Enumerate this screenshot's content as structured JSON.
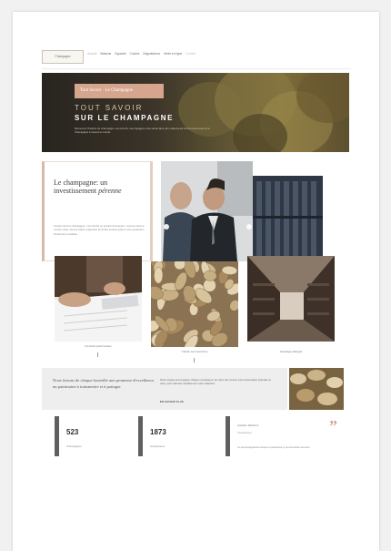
{
  "header": {
    "logo_text": "Champagne",
    "nav": [
      "Accueil",
      "Maisons",
      "Vignoble",
      "Cuvées",
      "Dégustations",
      "Vente en ligne",
      "Contact"
    ]
  },
  "hero": {
    "tag": "Tout Savoir · Le Champagne",
    "title_line1": "TOUT SAVOIR",
    "title_line2": "SUR LE CHAMPAGNE",
    "text": "Découvrez l'histoire du champagne, ses terroirs, ses cépages et les savoir-faire des maisons qui font la renommée de la Champagne à travers le monde."
  },
  "intro": {
    "heading": "Le champagne: un investissement",
    "heading_em": "pérenne",
    "text": "Investir dans le champagne, c'est choisir un produit d'exception, reconnu dans le monde entier, dont la valeur s'apprécie au fil des années grâce à une production strictement encadrée."
  },
  "tiles": [
    {
      "caption": "Conseils patrimoniaux"
    },
    {
      "caption": "Choisir ses bouchons"
    },
    {
      "caption": "Stockage adéquat"
    }
  ],
  "quote": {
    "text": "Nous faisons de chaque bouteille une promesse d'excellence, un patrimoine à transmettre et à partager.",
    "body": "Notre équipe accompagne chaque investisseur, du choix des cuvées à la conservation optimale en cave, pour valoriser durablement votre collection.",
    "more": "EN SAVOIR PLUS"
  },
  "stats": [
    {
      "number": "523",
      "label": "Champagnes"
    },
    {
      "number": "1873",
      "label": "Investisseurs"
    }
  ],
  "testimonial": {
    "name": "Aurélien Martinez",
    "role": "Investisseur",
    "text": "Un accompagnement sérieux et passionné, je recommande vivement."
  },
  "colors": {
    "accent": "#d6a58e",
    "dark": "#28241f",
    "text": "#444444"
  }
}
